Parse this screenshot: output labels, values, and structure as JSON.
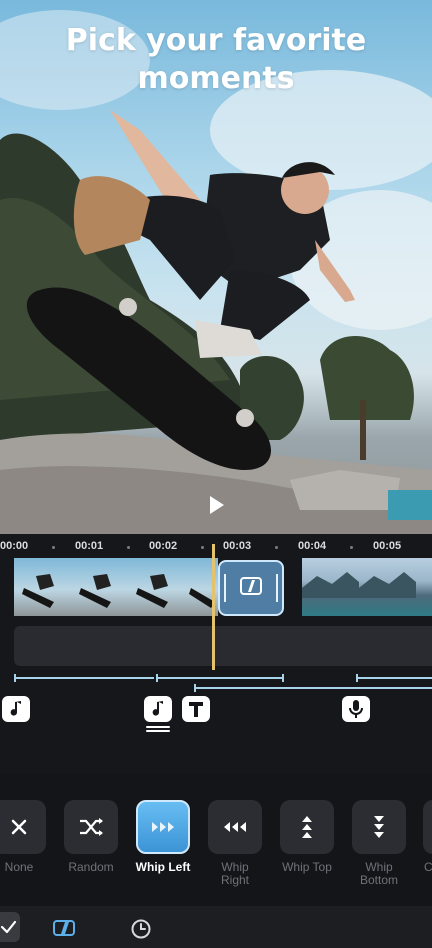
{
  "hero": {
    "title_line1": "Pick your favorite",
    "title_line2": "moments",
    "play_icon": "play-icon"
  },
  "timeline": {
    "ruler_labels": [
      "00:00",
      "00:01",
      "00:02",
      "00:03",
      "00:04",
      "00:05"
    ],
    "tools": [
      "music-note-icon",
      "music-stack-icon",
      "text-icon",
      "microphone-icon"
    ],
    "transition_icon": "transition-icon",
    "accent": "#e5c36d"
  },
  "transitions": [
    {
      "label": "None",
      "icon": "close-icon",
      "selected": false
    },
    {
      "label": "Random",
      "icon": "shuffle-icon",
      "selected": false
    },
    {
      "label": "Whip Left",
      "icon": "arrows-right-icon",
      "selected": true
    },
    {
      "label": "Whip Right",
      "icon": "arrows-left-icon",
      "selected": false
    },
    {
      "label": "Whip Top",
      "icon": "arrows-up-icon",
      "selected": false
    },
    {
      "label": "Whip Bottom",
      "icon": "arrows-down-icon",
      "selected": false
    },
    {
      "label": "C",
      "icon": "unknown-icon",
      "selected": false
    }
  ],
  "bottom_bar": {
    "icons": [
      "checkmark-icon",
      "transition-icon",
      "clock-icon"
    ]
  },
  "colors": {
    "selected": "#4fa6e6",
    "background": "#141519"
  }
}
